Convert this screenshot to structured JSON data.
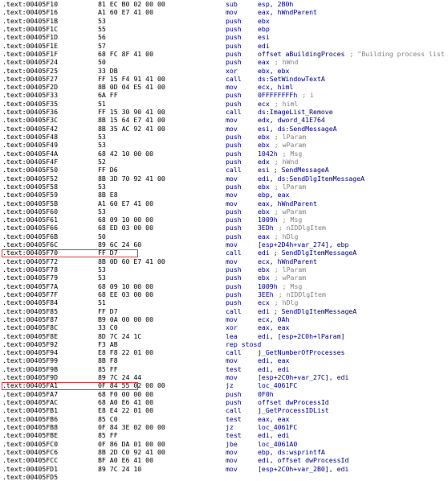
{
  "listing": {
    "rows": [
      {
        "addr": ".text:00405F10",
        "bytes": "81 EC B0 02 00 00",
        "mnem": "sub",
        "ops": "esp, 2B0h",
        "cmt": ""
      },
      {
        "addr": ".text:00405F16",
        "bytes": "A1 60 E7 41 00",
        "mnem": "mov",
        "ops": "eax, hWndParent",
        "cmt": ""
      },
      {
        "addr": ".text:00405F1B",
        "bytes": "53",
        "mnem": "push",
        "ops": "ebx",
        "cmt": ""
      },
      {
        "addr": ".text:00405F1C",
        "bytes": "55",
        "mnem": "push",
        "ops": "ebp",
        "cmt": ""
      },
      {
        "addr": ".text:00405F1D",
        "bytes": "56",
        "mnem": "push",
        "ops": "esi",
        "cmt": ""
      },
      {
        "addr": ".text:00405F1E",
        "bytes": "57",
        "mnem": "push",
        "ops": "edi",
        "cmt": ""
      },
      {
        "addr": ".text:00405F1F",
        "bytes": "68 FC 8F 41 00",
        "mnem": "push",
        "ops": "offset aBuildingProces",
        "cmt": "; \"Building process list"
      },
      {
        "addr": ".text:00405F24",
        "bytes": "50",
        "mnem": "push",
        "ops": "eax",
        "cmt": "; hWnd"
      },
      {
        "addr": ".text:00405F25",
        "bytes": "33 DB",
        "mnem": "xor",
        "ops": "ebx, ebx",
        "cmt": ""
      },
      {
        "addr": ".text:00405F27",
        "bytes": "FF 15 F4 91 41 00",
        "mnem": "call",
        "ops": "ds:SetWindowTextA",
        "cmt": ""
      },
      {
        "addr": ".text:00405F2D",
        "bytes": "8B 0D 04 E5 41 00",
        "mnem": "mov",
        "ops": "ecx, himl",
        "cmt": ""
      },
      {
        "addr": ".text:00405F33",
        "bytes": "6A FF",
        "mnem": "push",
        "ops": "0FFFFFFFFh",
        "cmt": "; i"
      },
      {
        "addr": ".text:00405F35",
        "bytes": "51",
        "mnem": "push",
        "ops": "ecx",
        "cmt": "; himl"
      },
      {
        "addr": ".text:00405F36",
        "bytes": "FF 15 30 90 41 00",
        "mnem": "call",
        "ops": "ds:ImageList_Remove",
        "cmt": ""
      },
      {
        "addr": ".text:00405F3C",
        "bytes": "8B 15 64 E7 41 00",
        "mnem": "mov",
        "ops": "edx, dword_41E764",
        "cmt": ""
      },
      {
        "addr": ".text:00405F42",
        "bytes": "8B 35 AC 92 41 00",
        "mnem": "mov",
        "ops": "esi, ds:SendMessageA",
        "cmt": ""
      },
      {
        "addr": ".text:00405F48",
        "bytes": "53",
        "mnem": "push",
        "ops": "ebx",
        "cmt": "; lParam"
      },
      {
        "addr": ".text:00405F49",
        "bytes": "53",
        "mnem": "push",
        "ops": "ebx",
        "cmt": "; wParam"
      },
      {
        "addr": ".text:00405F4A",
        "bytes": "68 42 10 00 00",
        "mnem": "push",
        "ops": "1042h",
        "cmt": "; Msg"
      },
      {
        "addr": ".text:00405F4F",
        "bytes": "52",
        "mnem": "push",
        "ops": "edx",
        "cmt": "; hWnd"
      },
      {
        "addr": ".text:00405F50",
        "bytes": "FF D6",
        "mnem": "call",
        "ops": "esi ; SendMessageA",
        "cmt": ""
      },
      {
        "addr": ".text:00405F52",
        "bytes": "8B 3D 70 92 41 00",
        "mnem": "mov",
        "ops": "edi, ds:SendDlgItemMessageA",
        "cmt": ""
      },
      {
        "addr": ".text:00405F58",
        "bytes": "53",
        "mnem": "push",
        "ops": "ebx",
        "cmt": "; lParam"
      },
      {
        "addr": ".text:00405F59",
        "bytes": "8B E8",
        "mnem": "mov",
        "ops": "ebp, eax",
        "cmt": ""
      },
      {
        "addr": ".text:00405F5B",
        "bytes": "A1 60 E7 41 00",
        "mnem": "mov",
        "ops": "eax, hWndParent",
        "cmt": ""
      },
      {
        "addr": ".text:00405F60",
        "bytes": "53",
        "mnem": "push",
        "ops": "ebx",
        "cmt": "; wParam"
      },
      {
        "addr": ".text:00405F61",
        "bytes": "68 09 10 00 00",
        "mnem": "push",
        "ops": "1009h",
        "cmt": "; Msg"
      },
      {
        "addr": ".text:00405F66",
        "bytes": "68 ED 03 00 00",
        "mnem": "push",
        "ops": "3EDh",
        "cmt": "; nIDDlgItem"
      },
      {
        "addr": ".text:00405F6B",
        "bytes": "50",
        "mnem": "push",
        "ops": "eax",
        "cmt": "; hDlg"
      },
      {
        "addr": ".text:00405F6C",
        "bytes": "89 6C 24 60",
        "mnem": "mov",
        "ops": "[esp+2D4h+var_274], ebp",
        "cmt": ""
      },
      {
        "addr": ".text:00405F70",
        "bytes": "FF D7",
        "mnem": "call",
        "ops": "edi ; SendDlgItemMessageA",
        "cmt": ""
      },
      {
        "addr": ".text:00405F72",
        "bytes": "8B 0D 60 E7 41 00",
        "mnem": "mov",
        "ops": "ecx, hWndParent",
        "cmt": ""
      },
      {
        "addr": ".text:00405F78",
        "bytes": "53",
        "mnem": "push",
        "ops": "ebx",
        "cmt": "; lParam"
      },
      {
        "addr": ".text:00405F79",
        "bytes": "53",
        "mnem": "push",
        "ops": "ebx",
        "cmt": "; wParam"
      },
      {
        "addr": ".text:00405F7A",
        "bytes": "68 09 10 00 00",
        "mnem": "push",
        "ops": "1009h",
        "cmt": "; Msg"
      },
      {
        "addr": ".text:00405F7F",
        "bytes": "68 EE 03 00 00",
        "mnem": "push",
        "ops": "3EEh",
        "cmt": "; nIDDlgItem"
      },
      {
        "addr": ".text:00405F84",
        "bytes": "51",
        "mnem": "push",
        "ops": "ecx",
        "cmt": "; hDlg"
      },
      {
        "addr": ".text:00405F85",
        "bytes": "FF D7",
        "mnem": "call",
        "ops": "edi ; SendDlgItemMessageA",
        "cmt": ""
      },
      {
        "addr": ".text:00405F87",
        "bytes": "B9 0A 00 00 00",
        "mnem": "mov",
        "ops": "ecx, 0Ah",
        "cmt": ""
      },
      {
        "addr": ".text:00405F8C",
        "bytes": "33 C0",
        "mnem": "xor",
        "ops": "eax, eax",
        "cmt": ""
      },
      {
        "addr": ".text:00405F8E",
        "bytes": "8D 7C 24 1C",
        "mnem": "lea",
        "ops": "edi, [esp+2C0h+lParam]",
        "cmt": ""
      },
      {
        "addr": ".text:00405F92",
        "bytes": "F3 AB",
        "mnem": "rep stosd",
        "ops": "",
        "cmt": ""
      },
      {
        "addr": ".text:00405F94",
        "bytes": "E8 F8 22 01 00",
        "mnem": "call",
        "ops": "j_GetNumberOfProcesses",
        "cmt": ""
      },
      {
        "addr": ".text:00405F99",
        "bytes": "8B F8",
        "mnem": "mov",
        "ops": "edi, eax",
        "cmt": ""
      },
      {
        "addr": ".text:00405F9B",
        "bytes": "85 FF",
        "mnem": "test",
        "ops": "edi, edi",
        "cmt": ""
      },
      {
        "addr": ".text:00405F9D",
        "bytes": "89 7C 24 44",
        "mnem": "mov",
        "ops": "[esp+2C0h+var_27C], edi",
        "cmt": ""
      },
      {
        "addr": ".text:00405FA1",
        "bytes": "0F 84 55 02 00 00",
        "mnem": "jz",
        "ops": "loc_4061FC",
        "cmt": ""
      },
      {
        "addr": ".text:00405FA7",
        "bytes": "68 F0 00 00 00",
        "mnem": "push",
        "ops": "0F0h",
        "cmt": ""
      },
      {
        "addr": ".text:00405FAC",
        "bytes": "68 A0 E6 41 00",
        "mnem": "push",
        "ops": "offset dwProcessId",
        "cmt": ""
      },
      {
        "addr": ".text:00405FB1",
        "bytes": "E8 E4 22 01 00",
        "mnem": "call",
        "ops": "j_GetProcessIDList",
        "cmt": ""
      },
      {
        "addr": ".text:00405FB6",
        "bytes": "85 C0",
        "mnem": "test",
        "ops": "eax, eax",
        "cmt": ""
      },
      {
        "addr": ".text:00405FB8",
        "bytes": "0F 84 3E 02 00 00",
        "mnem": "jz",
        "ops": "loc_4061FC",
        "cmt": ""
      },
      {
        "addr": ".text:00405FBE",
        "bytes": "85 FF",
        "mnem": "test",
        "ops": "edi, edi",
        "cmt": ""
      },
      {
        "addr": ".text:00405FC0",
        "bytes": "0F 86 DA 01 00 00",
        "mnem": "jbe",
        "ops": "loc_4061A0",
        "cmt": ""
      },
      {
        "addr": ".text:00405FC6",
        "bytes": "8B 2D C0 92 41 00",
        "mnem": "mov",
        "ops": "ebp, ds:wsprintfA",
        "cmt": ""
      },
      {
        "addr": ".text:00405FCC",
        "bytes": "BF A0 E6 41 00",
        "mnem": "mov",
        "ops": "edi, offset dwProcessId",
        "cmt": ""
      },
      {
        "addr": ".text:00405FD1",
        "bytes": "89 7C 24 10",
        "mnem": "mov",
        "ops": "[esp+2C0h+var_2B0], edi",
        "cmt": ""
      },
      {
        "addr": ".text:00405FD5",
        "bytes": "",
        "mnem": "",
        "ops": "",
        "cmt": ""
      }
    ],
    "highlighted_rows": [
      30,
      46
    ],
    "colors": {
      "text": "#000000",
      "mnemonic": "#00007f",
      "operand": "#000080",
      "comment": "#808080",
      "highlight_box": "#e0393e"
    }
  }
}
